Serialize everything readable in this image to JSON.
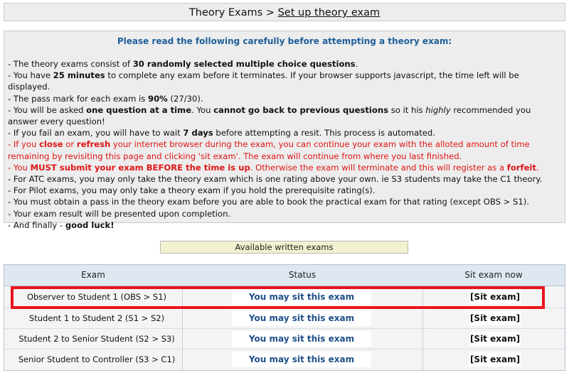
{
  "header": {
    "section": "Theory Exams",
    "separator": " > ",
    "current": "Set up theory exam"
  },
  "info": {
    "heading": "Please read the following carefully before attempting a theory exam:",
    "items": [
      {
        "pre": "- The theory exams consist of ",
        "bold": "30 randomly selected multiple choice questions",
        "post": "."
      },
      {
        "pre": "- You have ",
        "bold": "25 minutes",
        "post": " to complete any exam before it terminates. If your browser supports javascript, the time left will be displayed."
      },
      {
        "pre": "- The pass mark for each exam is ",
        "bold": "90%",
        "post": " (27/30)."
      }
    ],
    "item4": {
      "a": "- You will be asked ",
      "b": "one question at a time",
      "c": ". You ",
      "d": "cannot go back to previous questions",
      "e": " so it his ",
      "f": "highly",
      "g": " recommended you answer every question!"
    },
    "item5": {
      "a": "- If you fail an exam, you will have to wait ",
      "b": "7 days",
      "c": " before attempting a resit. This process is automated."
    },
    "item6": {
      "a": "- If you ",
      "b": "close",
      "c": " or ",
      "d": "refresh",
      "e": " your internet browser during the exam, you can continue your exam with the alloted amount of time remaining by revisiting this page and clicking 'sit exam'. The exam will continue from where you last finished."
    },
    "item7": {
      "a": "- You ",
      "b": "MUST submit your exam BEFORE the time is up",
      "c": ". Otherwise the exam will terminate and this will register as a ",
      "d": "forfeit",
      "e": "."
    },
    "plain": [
      "- For ATC exams, you may only take the theory exam which is one rating above your own. ie S3 students may take the C1 theory.",
      "- For Pilot exams, you may only take a theory exam if you hold the prerequisite rating(s).",
      "- You must obtain a pass in the theory exam before you are able to book the practical exam for that rating (except OBS > S1).",
      "- Your exam result will be presented upon completion."
    ],
    "final": {
      "a": "- And finally - ",
      "b": "good luck!"
    }
  },
  "available_label": "Available written exams",
  "table": {
    "columns": [
      "Exam",
      "Status",
      "Sit exam now"
    ],
    "rows": [
      {
        "exam": "Observer to Student 1 (OBS > S1)",
        "status": "You may sit this exam",
        "action": "[Sit exam]"
      },
      {
        "exam": "Student 1 to Student 2 (S1 > S2)",
        "status": "You may sit this exam",
        "action": "[Sit exam]"
      },
      {
        "exam": "Student 2 to Senior Student (S2 > S3)",
        "status": "You may sit this exam",
        "action": "[Sit exam]"
      },
      {
        "exam": "Senior Student to Controller (S3 > C1)",
        "status": "You may sit this exam",
        "action": "[Sit exam]"
      }
    ]
  },
  "colors": {
    "heading_blue": "#1f5f9a",
    "status_blue": "#1f4f8a",
    "warning_red": "#e01515",
    "highlight_red": "#e8141e"
  }
}
